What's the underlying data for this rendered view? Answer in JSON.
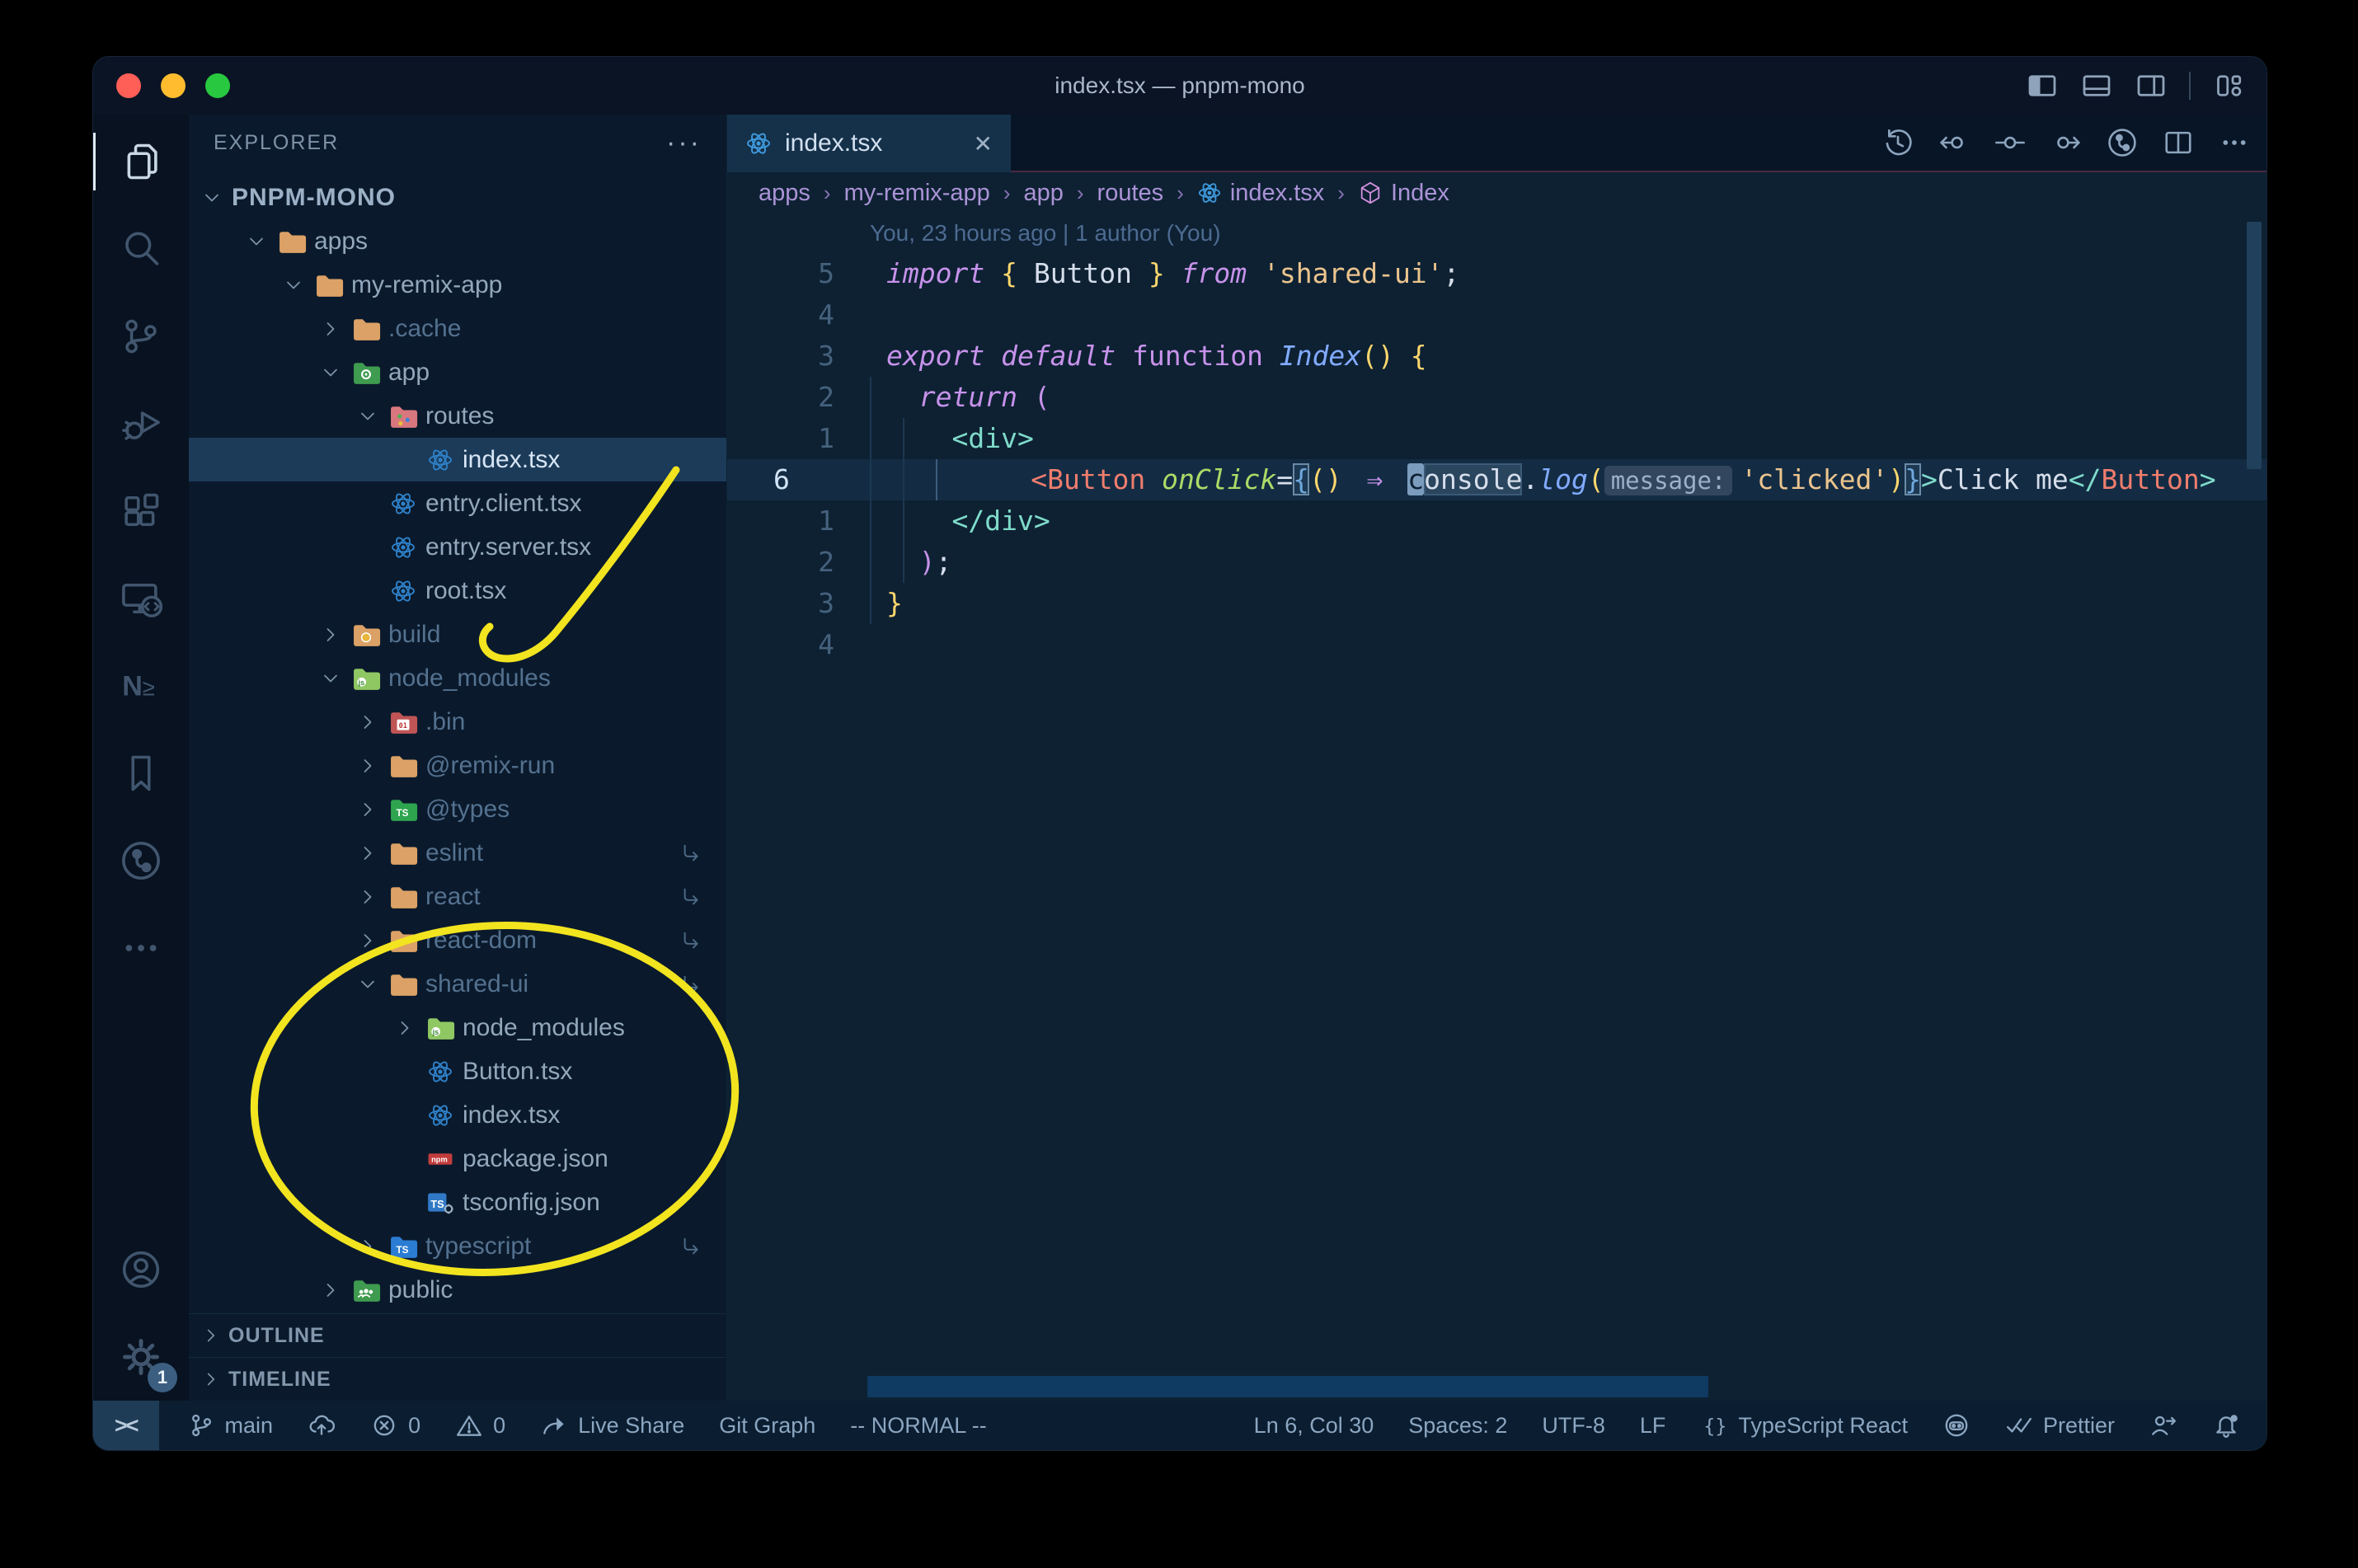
{
  "window": {
    "title": "index.tsx — pnpm-mono"
  },
  "titlebar_icons": [
    "layout-sidebar-left",
    "layout-panel",
    "layout-sidebar-right",
    "separator",
    "layout-customize"
  ],
  "activity_bar": {
    "items": [
      {
        "name": "explorer",
        "icon": "files",
        "active": true
      },
      {
        "name": "search",
        "icon": "search",
        "active": false
      },
      {
        "name": "source-control",
        "icon": "source-control",
        "active": false
      },
      {
        "name": "run-debug",
        "icon": "debug",
        "active": false
      },
      {
        "name": "extensions",
        "icon": "extensions",
        "active": false
      },
      {
        "name": "remote-explorer",
        "icon": "remote-explorer",
        "active": false
      },
      {
        "name": "nx-console",
        "icon": "nx",
        "active": false
      },
      {
        "name": "bookmarks",
        "icon": "bookmark",
        "active": false
      },
      {
        "name": "git-graph",
        "icon": "git-graph",
        "active": false
      },
      {
        "name": "more-views",
        "icon": "ellipsis",
        "active": false
      }
    ],
    "bottom": [
      {
        "name": "accounts",
        "icon": "account"
      },
      {
        "name": "settings",
        "icon": "gear",
        "badge": "1"
      }
    ]
  },
  "explorer": {
    "title": "EXPLORER",
    "actions": "···",
    "tree": [
      {
        "label": "PNPM-MONO",
        "level": 0,
        "chevron": "down",
        "icon": "",
        "root": true
      },
      {
        "label": "apps",
        "level": 1,
        "chevron": "down",
        "icon": "folder-tan"
      },
      {
        "label": "my-remix-app",
        "level": 2,
        "chevron": "down",
        "icon": "folder-tan"
      },
      {
        "label": ".cache",
        "level": 3,
        "chevron": "right",
        "icon": "folder-tan",
        "dim": true
      },
      {
        "label": "app",
        "level": 3,
        "chevron": "down",
        "icon": "folder-app"
      },
      {
        "label": "routes",
        "level": 4,
        "chevron": "down",
        "icon": "folder-routes"
      },
      {
        "label": "index.tsx",
        "level": 5,
        "chevron": "none",
        "icon": "react",
        "selected": true
      },
      {
        "label": "entry.client.tsx",
        "level": 4,
        "chevron": "none",
        "icon": "react"
      },
      {
        "label": "entry.server.tsx",
        "level": 4,
        "chevron": "none",
        "icon": "react"
      },
      {
        "label": "root.tsx",
        "level": 4,
        "chevron": "none",
        "icon": "react"
      },
      {
        "label": "build",
        "level": 3,
        "chevron": "right",
        "icon": "folder-dist",
        "dim": true
      },
      {
        "label": "node_modules",
        "level": 3,
        "chevron": "down",
        "icon": "folder-node",
        "dim": true
      },
      {
        "label": ".bin",
        "level": 4,
        "chevron": "right",
        "icon": "folder-bin",
        "dim": true
      },
      {
        "label": "@remix-run",
        "level": 4,
        "chevron": "right",
        "icon": "folder-tan",
        "dim": true
      },
      {
        "label": "@types",
        "level": 4,
        "chevron": "right",
        "icon": "folder-types",
        "dim": true
      },
      {
        "label": "eslint",
        "level": 4,
        "chevron": "right",
        "icon": "folder-tan",
        "dim": true,
        "symlink": true
      },
      {
        "label": "react",
        "level": 4,
        "chevron": "right",
        "icon": "folder-tan",
        "dim": true,
        "symlink": true
      },
      {
        "label": "react-dom",
        "level": 4,
        "chevron": "right",
        "icon": "folder-tan",
        "dim": true,
        "symlink": true
      },
      {
        "label": "shared-ui",
        "level": 4,
        "chevron": "down",
        "icon": "folder-tan",
        "dim": true,
        "symlink": true
      },
      {
        "label": "node_modules",
        "level": 5,
        "chevron": "right",
        "icon": "folder-node"
      },
      {
        "label": "Button.tsx",
        "level": 5,
        "chevron": "none",
        "icon": "react"
      },
      {
        "label": "index.tsx",
        "level": 5,
        "chevron": "none",
        "icon": "react"
      },
      {
        "label": "package.json",
        "level": 5,
        "chevron": "none",
        "icon": "npm"
      },
      {
        "label": "tsconfig.json",
        "level": 5,
        "chevron": "none",
        "icon": "tsgear"
      },
      {
        "label": "typescript",
        "level": 4,
        "chevron": "right",
        "icon": "folder-ts",
        "dim": true,
        "symlink": true
      },
      {
        "label": "public",
        "level": 3,
        "chevron": "right",
        "icon": "folder-public"
      }
    ],
    "sections": [
      "OUTLINE",
      "TIMELINE"
    ]
  },
  "tab": {
    "label": "index.tsx",
    "close": "✕"
  },
  "editor_toolbar": [
    "history",
    "prev-change",
    "change",
    "next-change",
    "git-graph",
    "split-editor",
    "ellipsis"
  ],
  "breadcrumbs": [
    {
      "label": "apps"
    },
    {
      "label": "my-remix-app"
    },
    {
      "label": "app"
    },
    {
      "label": "routes"
    },
    {
      "label": "index.tsx",
      "icon": "react"
    },
    {
      "label": "Index",
      "icon": "cube"
    }
  ],
  "editor": {
    "blame": "You, 23 hours ago | 1 author (You)",
    "lines": [
      {
        "num": "5",
        "tokens": [
          [
            "kw",
            "import "
          ],
          [
            "py",
            "{ "
          ],
          [
            "id",
            "Button "
          ],
          [
            "py",
            "} "
          ],
          [
            "kw",
            "from "
          ],
          [
            "str",
            "'shared-ui'"
          ],
          [
            "p",
            ";"
          ]
        ]
      },
      {
        "num": "4",
        "tokens": []
      },
      {
        "num": "3",
        "tokens": [
          [
            "kw",
            "export default "
          ],
          [
            "kwu",
            "function "
          ],
          [
            "fn",
            "Index"
          ],
          [
            "py",
            "()"
          ],
          [
            "p",
            " "
          ],
          [
            "py",
            "{"
          ]
        ]
      },
      {
        "num": "2",
        "tokens": [
          [
            "p",
            "  "
          ],
          [
            "kw",
            "return "
          ],
          [
            "pm",
            "("
          ]
        ]
      },
      {
        "num": "1",
        "tokens": [
          [
            "p",
            "    "
          ],
          [
            "tag",
            "<div>"
          ]
        ]
      },
      {
        "num": "6",
        "current": true,
        "tokens": [
          [
            "p",
            "      "
          ],
          [
            "cmp",
            "<Button"
          ],
          [
            "p",
            " "
          ],
          [
            "attr",
            "onClick"
          ],
          [
            "p",
            "="
          ],
          [
            "bm",
            "{"
          ],
          [
            "py",
            "()"
          ],
          [
            "p",
            " "
          ],
          [
            "arrow",
            "⇒"
          ],
          [
            "p",
            " "
          ],
          [
            "cur",
            "c"
          ],
          [
            "hl",
            "onsole"
          ],
          [
            "p",
            "."
          ],
          [
            "fn",
            "log"
          ],
          [
            "py",
            "("
          ],
          [
            "hint",
            "message:"
          ],
          [
            "str",
            "'clicked'"
          ],
          [
            "py",
            ")"
          ],
          [
            "bm",
            "}"
          ],
          [
            "tag",
            ">"
          ],
          [
            "id",
            "Click me"
          ],
          [
            "tag",
            "</"
          ],
          [
            "cmp",
            "Button"
          ],
          [
            "tag",
            ">"
          ]
        ]
      },
      {
        "num": "1",
        "tokens": [
          [
            "p",
            "    "
          ],
          [
            "tag",
            "</div>"
          ]
        ]
      },
      {
        "num": "2",
        "tokens": [
          [
            "p",
            "  "
          ],
          [
            "pm",
            ")"
          ],
          [
            "p",
            ";"
          ]
        ]
      },
      {
        "num": "3",
        "tokens": [
          [
            "py",
            "}"
          ]
        ]
      },
      {
        "num": "4",
        "tokens": []
      }
    ]
  },
  "status_bar": {
    "remote": "><",
    "left": [
      {
        "name": "git-branch",
        "icon": "branch",
        "label": "main"
      },
      {
        "name": "publish",
        "icon": "cloud-upload",
        "label": ""
      },
      {
        "name": "errors",
        "icon": "error",
        "label": "0"
      },
      {
        "name": "warnings",
        "icon": "warning",
        "label": "0"
      },
      {
        "name": "live-share",
        "icon": "live-share",
        "label": "Live Share"
      },
      {
        "name": "git-graph",
        "label": "Git Graph"
      },
      {
        "name": "vim-mode",
        "label": "-- NORMAL --"
      }
    ],
    "right": [
      {
        "name": "cursor-position",
        "label": "Ln 6, Col 30"
      },
      {
        "name": "indentation",
        "label": "Spaces: 2"
      },
      {
        "name": "encoding",
        "label": "UTF-8"
      },
      {
        "name": "eol",
        "label": "LF"
      },
      {
        "name": "language-mode",
        "icon": "braces",
        "label": "TypeScript React"
      },
      {
        "name": "copilot",
        "icon": "copilot",
        "label": ""
      },
      {
        "name": "prettier",
        "icon": "double-check",
        "label": "Prettier"
      },
      {
        "name": "feedback",
        "icon": "feedback",
        "label": ""
      },
      {
        "name": "notifications",
        "icon": "bell",
        "label": ""
      }
    ]
  },
  "annotation_color": "#f2e41f",
  "colors": {
    "traffic_red": "#ff5f57",
    "traffic_yellow": "#febc2e",
    "traffic_green": "#28c840",
    "react_blue": "#2f81c9",
    "folder_tan": "#dca166",
    "npm_red": "#c23c3c",
    "ts_blue": "#3179c6"
  }
}
